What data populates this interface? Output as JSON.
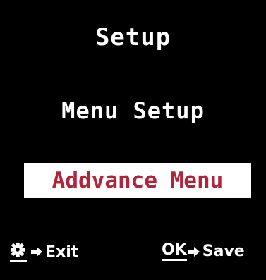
{
  "screen": {
    "title": "Setup",
    "menu_items": [
      {
        "label": "Menu Setup",
        "selected": false
      },
      {
        "label": "Addvance Menu",
        "selected": true
      }
    ],
    "footer": {
      "exit_label": "Exit",
      "ok_key_label": "OK",
      "save_label": "Save"
    }
  },
  "colors": {
    "background": "#000000",
    "text": "#ffffff",
    "highlight_background": "#ffffff",
    "highlight_text": "#b3243a"
  },
  "icons": {
    "menu_key": "gear-icon",
    "arrow": "arrow-right-icon"
  }
}
